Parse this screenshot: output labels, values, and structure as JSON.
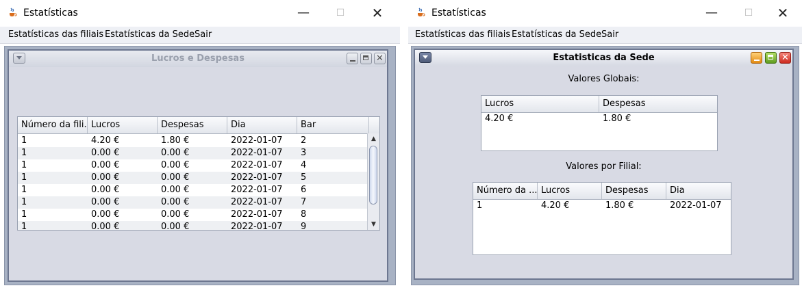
{
  "windows": [
    {
      "title": "Estatísticas",
      "menu": [
        "Estatísticas das filiais",
        "Estatísticas da Sede",
        "Sair"
      ],
      "internal_frame": {
        "title": "Lucros e Despesas",
        "table": {
          "columns": [
            "Número da fili...",
            "Lucros",
            "Despesas",
            "Dia",
            "Bar"
          ],
          "rows": [
            [
              "1",
              "4.20 €",
              "1.80 €",
              "2022-01-07",
              "2"
            ],
            [
              "1",
              "0.00 €",
              "0.00 €",
              "2022-01-07",
              "3"
            ],
            [
              "1",
              "0.00 €",
              "0.00 €",
              "2022-01-07",
              "4"
            ],
            [
              "1",
              "0.00 €",
              "0.00 €",
              "2022-01-07",
              "5"
            ],
            [
              "1",
              "0.00 €",
              "0.00 €",
              "2022-01-07",
              "6"
            ],
            [
              "1",
              "0.00 €",
              "0.00 €",
              "2022-01-07",
              "7"
            ],
            [
              "1",
              "0.00 €",
              "0.00 €",
              "2022-01-07",
              "8"
            ],
            [
              "1",
              "0.00 €",
              "0.00 €",
              "2022-01-07",
              "9"
            ]
          ]
        }
      }
    },
    {
      "title": "Estatísticas",
      "menu": [
        "Estatísticas das filiais",
        "Estatísticas da Sede",
        "Sair"
      ],
      "internal_frame": {
        "title": "Estatisticas da Sede",
        "global_label": "Valores Globais:",
        "global_table": {
          "columns": [
            "Lucros",
            "Despesas"
          ],
          "rows": [
            [
              "4.20 €",
              "1.80 €"
            ]
          ]
        },
        "filial_label": "Valores por Filial:",
        "filial_table": {
          "columns": [
            "Número da ...",
            "Lucros",
            "Despesas",
            "Dia"
          ],
          "rows": [
            [
              "1",
              "4.20 €",
              "1.80 €",
              "2022-01-07"
            ]
          ]
        }
      }
    }
  ],
  "icons": {
    "app": "java-coffee-icon",
    "minimize": "minimize-icon",
    "maximize": "maximize-icon",
    "close": "close-icon",
    "system_menu": "chevron-down-icon"
  },
  "colors": {
    "desktop": "#a8b2c4",
    "frame_bg": "#d8dae4",
    "minimize_button": "#e28a12",
    "maximize_button": "#5e9c1e",
    "close_button": "#cc2a1e"
  }
}
